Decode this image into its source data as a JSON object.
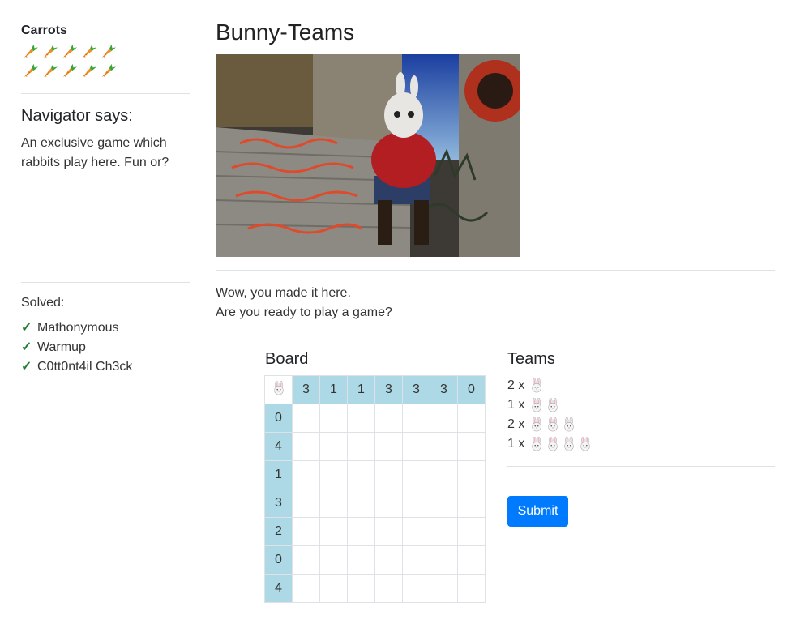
{
  "sidebar": {
    "carrots_label": "Carrots",
    "carrot_count": 10,
    "carrot_icon": "carrot-icon",
    "navigator_heading": "Navigator says:",
    "navigator_text": "An exclusive game which rabbits play here. Fun or?",
    "solved_label": "Solved:",
    "solved_items": [
      "Mathonymous",
      "Warmup",
      "C0tt0nt4il Ch3ck"
    ],
    "check_glyph": "✓"
  },
  "main": {
    "title": "Bunny-Teams",
    "intro_line1": "Wow, you made it here.",
    "intro_line2": "Are you ready to play a game?"
  },
  "board": {
    "title": "Board",
    "corner_icon": "bunny-icon",
    "column_headers": [
      "3",
      "1",
      "1",
      "3",
      "3",
      "3",
      "0"
    ],
    "row_headers": [
      "0",
      "4",
      "1",
      "3",
      "2",
      "0",
      "4"
    ]
  },
  "teams": {
    "title": "Teams",
    "items": [
      {
        "count_label": "2 x",
        "bunnies": 1
      },
      {
        "count_label": "1 x",
        "bunnies": 2
      },
      {
        "count_label": "2 x",
        "bunnies": 3
      },
      {
        "count_label": "1 x",
        "bunnies": 4
      }
    ],
    "submit_label": "Submit"
  },
  "colors": {
    "header_cell": "#add8e6",
    "submit": "#007bff",
    "check": "#1e7e34"
  }
}
